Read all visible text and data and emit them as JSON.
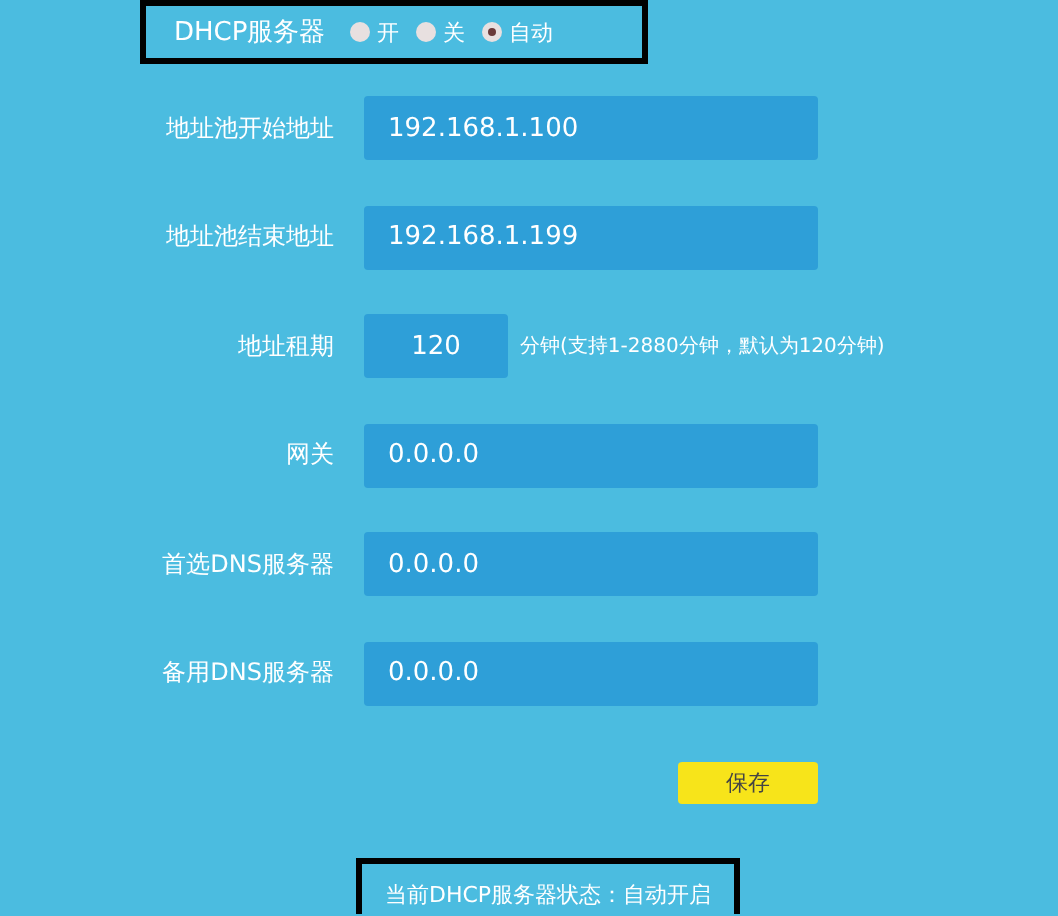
{
  "dhcp": {
    "label": "DHCP服务器",
    "options": [
      {
        "label": "开",
        "selected": false
      },
      {
        "label": "关",
        "selected": false
      },
      {
        "label": "自动",
        "selected": true
      }
    ]
  },
  "fields": [
    {
      "label": "地址池开始地址",
      "value": "192.168.1.100",
      "kind": "wide"
    },
    {
      "label": "地址池结束地址",
      "value": "192.168.1.199",
      "kind": "wide"
    },
    {
      "label": "地址租期",
      "value": "120",
      "kind": "short",
      "hint": "分钟(支持1-2880分钟，默认为120分钟)"
    },
    {
      "label": "网关",
      "value": "0.0.0.0",
      "kind": "wide"
    },
    {
      "label": "首选DNS服务器",
      "value": "0.0.0.0",
      "kind": "wide"
    },
    {
      "label": "备用DNS服务器",
      "value": "0.0.0.0",
      "kind": "wide"
    }
  ],
  "save_button": "保存",
  "status": "当前DHCP服务器状态：自动开启"
}
